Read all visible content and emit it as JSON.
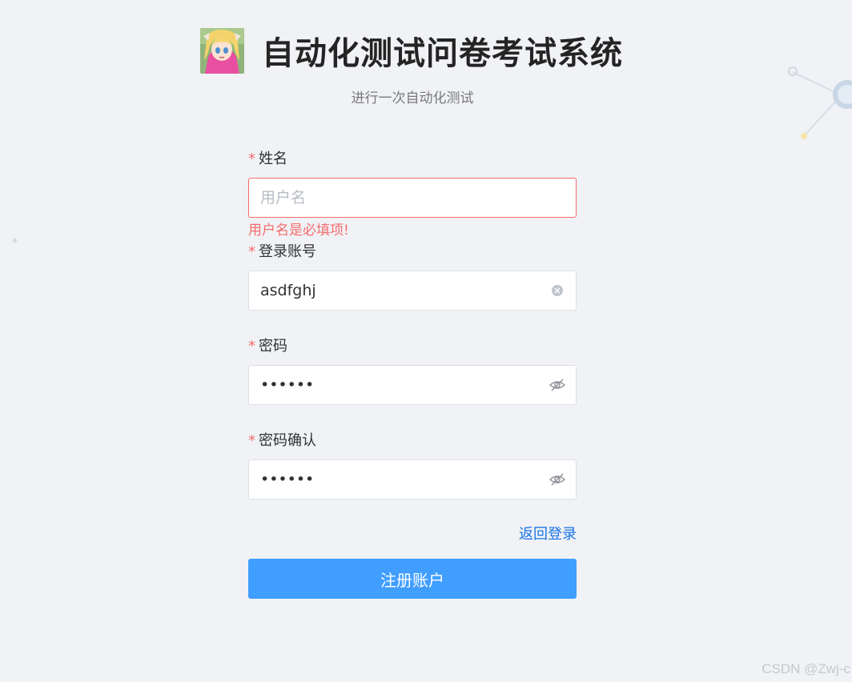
{
  "header": {
    "title": "自动化测试问卷考试系统",
    "subtitle": "进行一次自动化测试"
  },
  "form": {
    "name": {
      "label": "姓名",
      "required_mark": "*",
      "value": "",
      "placeholder": "用户名",
      "error": "用户名是必填项!"
    },
    "account": {
      "label": "登录账号",
      "required_mark": "*",
      "value": "asdfghj",
      "suffix_icon": "clear-circle-icon"
    },
    "password": {
      "label": "密码",
      "required_mark": "*",
      "value": "••••••",
      "suffix_icon": "eye-hidden-icon"
    },
    "password_confirm": {
      "label": "密码确认",
      "required_mark": "*",
      "value": "••••••",
      "suffix_icon": "eye-hidden-icon"
    },
    "back_to_login": "返回登录",
    "submit_label": "注册账户"
  },
  "colors": {
    "background": "#f0f2f5",
    "primary": "#409eff",
    "error": "#f56c6c",
    "link": "#1a73e8"
  },
  "watermark": "CSDN @Zwj-c"
}
